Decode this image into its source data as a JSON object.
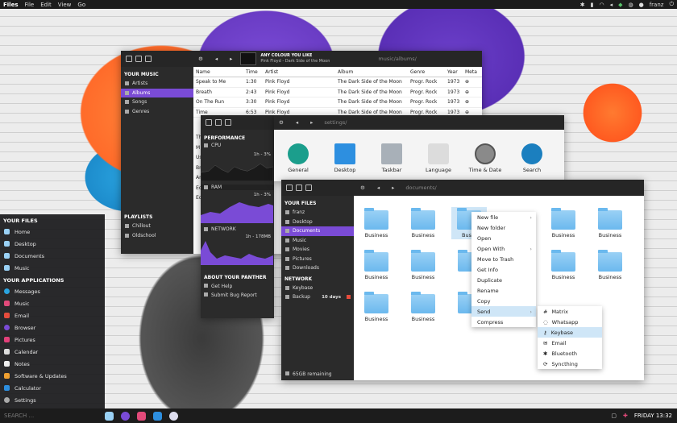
{
  "topbar": {
    "app": "Files",
    "menus": [
      "File",
      "Edit",
      "View",
      "Go"
    ],
    "user": "franz"
  },
  "music": {
    "sidebar_title": "YOUR MUSIC",
    "items": [
      "Artists",
      "Albums",
      "Songs",
      "Genres"
    ],
    "playlists_title": "PLAYLISTS",
    "playlists": [
      "Chillout",
      "Oldschool"
    ],
    "now_playing_title": "ANY COLOUR YOU LIKE",
    "now_playing_sub": "Pink Floyd - Dark Side of the Moon",
    "path": "music/albums/",
    "columns": [
      "Name",
      "Time",
      "Artist",
      "Album",
      "Genre",
      "Year",
      "Meta"
    ],
    "rows": [
      [
        "Speak to Me",
        "1:30",
        "Pink Floyd",
        "The Dark Side of the Moon",
        "Progr. Rock",
        "1973"
      ],
      [
        "Breath",
        "2:43",
        "Pink Floyd",
        "The Dark Side of the Moon",
        "Progr. Rock",
        "1973"
      ],
      [
        "On The Run",
        "3:30",
        "Pink Floyd",
        "The Dark Side of the Moon",
        "Progr. Rock",
        "1973"
      ],
      [
        "Time",
        "6:53",
        "Pink Floyd",
        "The Dark Side of the Moon",
        "Progr. Rock",
        "1973"
      ]
    ],
    "partial_rows": [
      "Th",
      "M",
      "Us",
      "Br",
      "An",
      "Ec",
      "Ec"
    ]
  },
  "monitor": {
    "title": "PERFORMANCE",
    "cpu": "CPU",
    "cpu_range": "1h - 3%",
    "ram": "RAM",
    "ram_range": "1h - 3%",
    "net": "NETWORK",
    "net_range": "1h - 178MB",
    "about_title": "ABOUT YOUR PANTHER",
    "help": "Get Help",
    "bug": "Submit Bug Report"
  },
  "settings": {
    "path": "settings/",
    "items": [
      "General",
      "Desktop",
      "Taskbar",
      "Language",
      "Time & Date",
      "Search"
    ]
  },
  "files": {
    "path": "documents/",
    "files_title": "YOUR FILES",
    "items": [
      "franz",
      "Desktop",
      "Documents",
      "Music",
      "Movies",
      "Pictures",
      "Downloads"
    ],
    "network_title": "NETWORK",
    "network": [
      "Keybase",
      "Backup"
    ],
    "backup_age": "10 days",
    "remaining": "65GB remaining",
    "folder_name": "Business",
    "partial": "Busin"
  },
  "context": {
    "items": [
      "New file",
      "New folder",
      "Open",
      "Open With",
      "Move to Trash",
      "Get Info",
      "Duplicate",
      "Rename",
      "Copy",
      "Send",
      "Compress"
    ]
  },
  "send": {
    "items": [
      "Matrix",
      "Whatsapp",
      "Keybase",
      "Email",
      "Bluetooth",
      "Syncthing"
    ]
  },
  "menu": {
    "files_title": "YOUR FILES",
    "files": [
      "Home",
      "Desktop",
      "Documents",
      "Music"
    ],
    "apps_title": "YOUR APPLICATIONS",
    "apps": [
      "Messages",
      "Music",
      "Email",
      "Browser",
      "Pictures",
      "Calendar",
      "Notes",
      "Software & Updates",
      "Calculator",
      "Settings"
    ]
  },
  "taskbar": {
    "search": "SEARCH ...",
    "clock": "FRIDAY 13:32"
  },
  "colors": {
    "accent": "#7a4bd6",
    "dark": "#262626",
    "folder": "#6bb9ee"
  }
}
